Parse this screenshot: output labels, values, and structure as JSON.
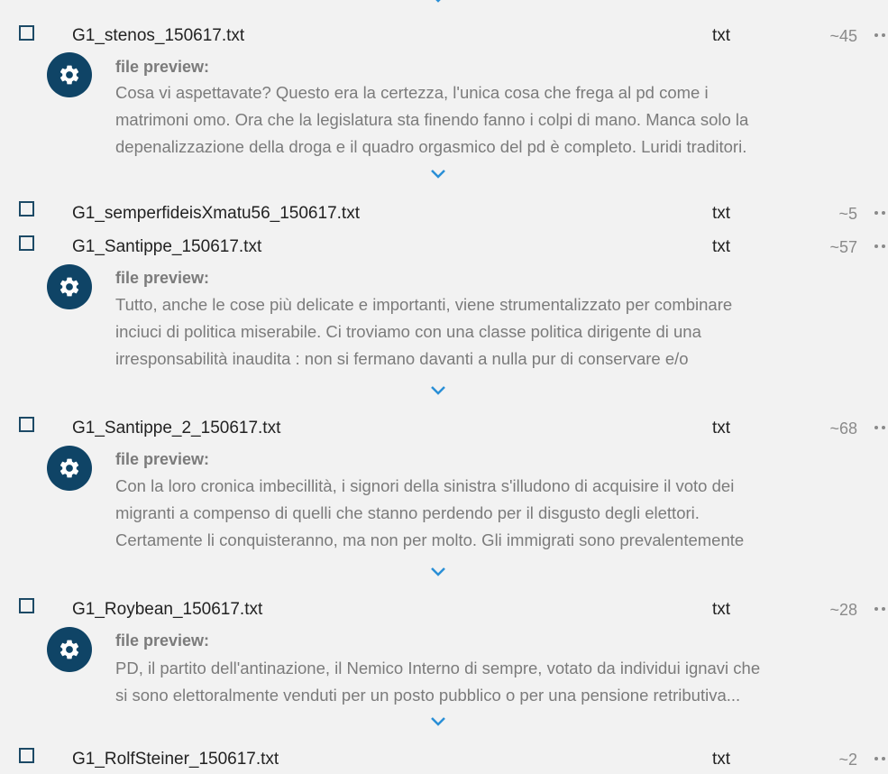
{
  "preview_label": "file preview:",
  "files": [
    {
      "name": "G1_stenos_150617.txt",
      "type": "txt",
      "size": "~45",
      "preview_lines": [
        "Cosa vi aspettavate? Questo era la certezza, l'unica cosa che frega al pd come i",
        "matrimoni omo. Ora che la legislatura sta finendo fanno i colpi di mano. Manca solo la",
        "depenalizzazione della droga e il quadro orgasmico del pd è completo. Luridi traditori."
      ]
    },
    {
      "name": "G1_semperfideisXmatu56_150617.txt",
      "type": "txt",
      "size": "~5"
    },
    {
      "name": "G1_Santippe_150617.txt",
      "type": "txt",
      "size": "~57",
      "preview_lines": [
        "Tutto, anche le cose più delicate e importanti, viene strumentalizzato per combinare",
        "inciuci di politica miserabile. Ci troviamo con una classe politica dirigente di una",
        "irresponsabilità inaudita : non si fermano davanti a nulla pur di conservare e/o"
      ]
    },
    {
      "name": "G1_Santippe_2_150617.txt",
      "type": "txt",
      "size": "~68",
      "preview_lines": [
        "Con la loro cronica imbecillità, i signori della sinistra s'illudono di acquisire il voto dei",
        "migranti a compenso di quelli che stanno perdendo per il disgusto degli elettori.",
        "Certamente li conquisteranno, ma non per molto. Gli immigrati sono prevalentemente"
      ]
    },
    {
      "name": "G1_Roybean_150617.txt",
      "type": "txt",
      "size": "~28",
      "preview_lines": [
        "PD, il partito dell'antinazione, il Nemico Interno di sempre, votato da individui ignavi che",
        "si sono elettoralmente venduti per un posto pubblico o per una pensione retributiva..."
      ]
    },
    {
      "name": "G1_RolfSteiner_150617.txt",
      "type": "txt",
      "size": "~2"
    }
  ],
  "icons": {
    "settings": "gear-icon",
    "expand": "chevron-down-icon",
    "menu": "more-dots-icon",
    "select": "checkbox"
  },
  "colors": {
    "accent_dark": "#0f4466",
    "chevron": "#2a8fd6",
    "muted_text": "#7b7b7b",
    "background": "#f2f2f2"
  }
}
